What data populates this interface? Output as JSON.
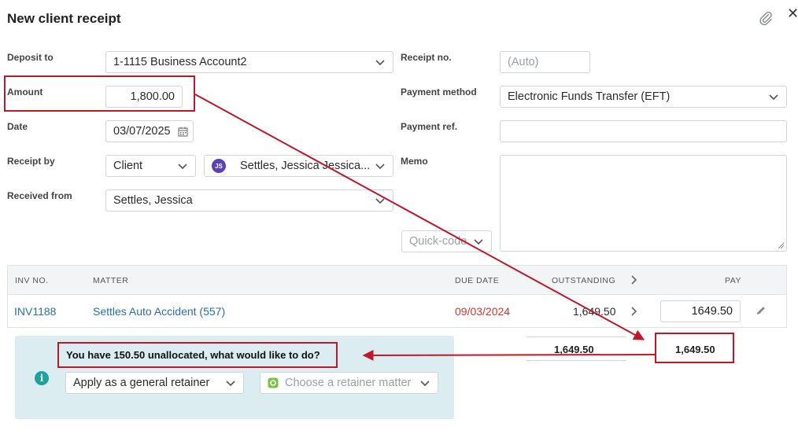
{
  "dialog": {
    "title": "New client receipt"
  },
  "form": {
    "deposit_to": {
      "label": "Deposit to",
      "value": "1-1115 Business Account2"
    },
    "amount": {
      "label": "Amount",
      "value": "1,800.00"
    },
    "date": {
      "label": "Date",
      "value": "03/07/2025"
    },
    "receipt_by": {
      "label": "Receipt by",
      "type_value": "Client",
      "avatar_initials": "JS",
      "contact_value": "Settles, Jessica Jessica..."
    },
    "received_from": {
      "label": "Received from",
      "value": "Settles, Jessica"
    },
    "receipt_no": {
      "label": "Receipt no.",
      "placeholder": "(Auto)"
    },
    "payment_method": {
      "label": "Payment method",
      "value": "Electronic Funds Transfer (EFT)"
    },
    "payment_ref": {
      "label": "Payment ref.",
      "value": ""
    },
    "memo": {
      "label": "Memo",
      "value": ""
    },
    "quick_code": {
      "placeholder": "Quick-code"
    }
  },
  "table": {
    "headers": {
      "inv_no": "INV NO.",
      "matter": "MATTER",
      "due_date": "DUE DATE",
      "outstanding": "OUTSTANDING",
      "pay": "PAY"
    },
    "rows": [
      {
        "inv_no": "INV1188",
        "matter": "Settles Auto Accident (557)",
        "due_date": "09/03/2024",
        "outstanding": "1,649.50",
        "pay": "1649.50"
      }
    ],
    "totals": {
      "outstanding": "1,649.50",
      "pay": "1,649.50"
    }
  },
  "unallocated": {
    "message": "You have 150.50 unallocated, what would like to do?",
    "action_value": "Apply as a general retainer",
    "matter_placeholder": "Choose a retainer matter"
  },
  "colors": {
    "annotation_red": "#c0182b",
    "link_blue": "#2a6ea6",
    "overdue_red": "#d9342b",
    "info_panel": "#dcedf2"
  }
}
